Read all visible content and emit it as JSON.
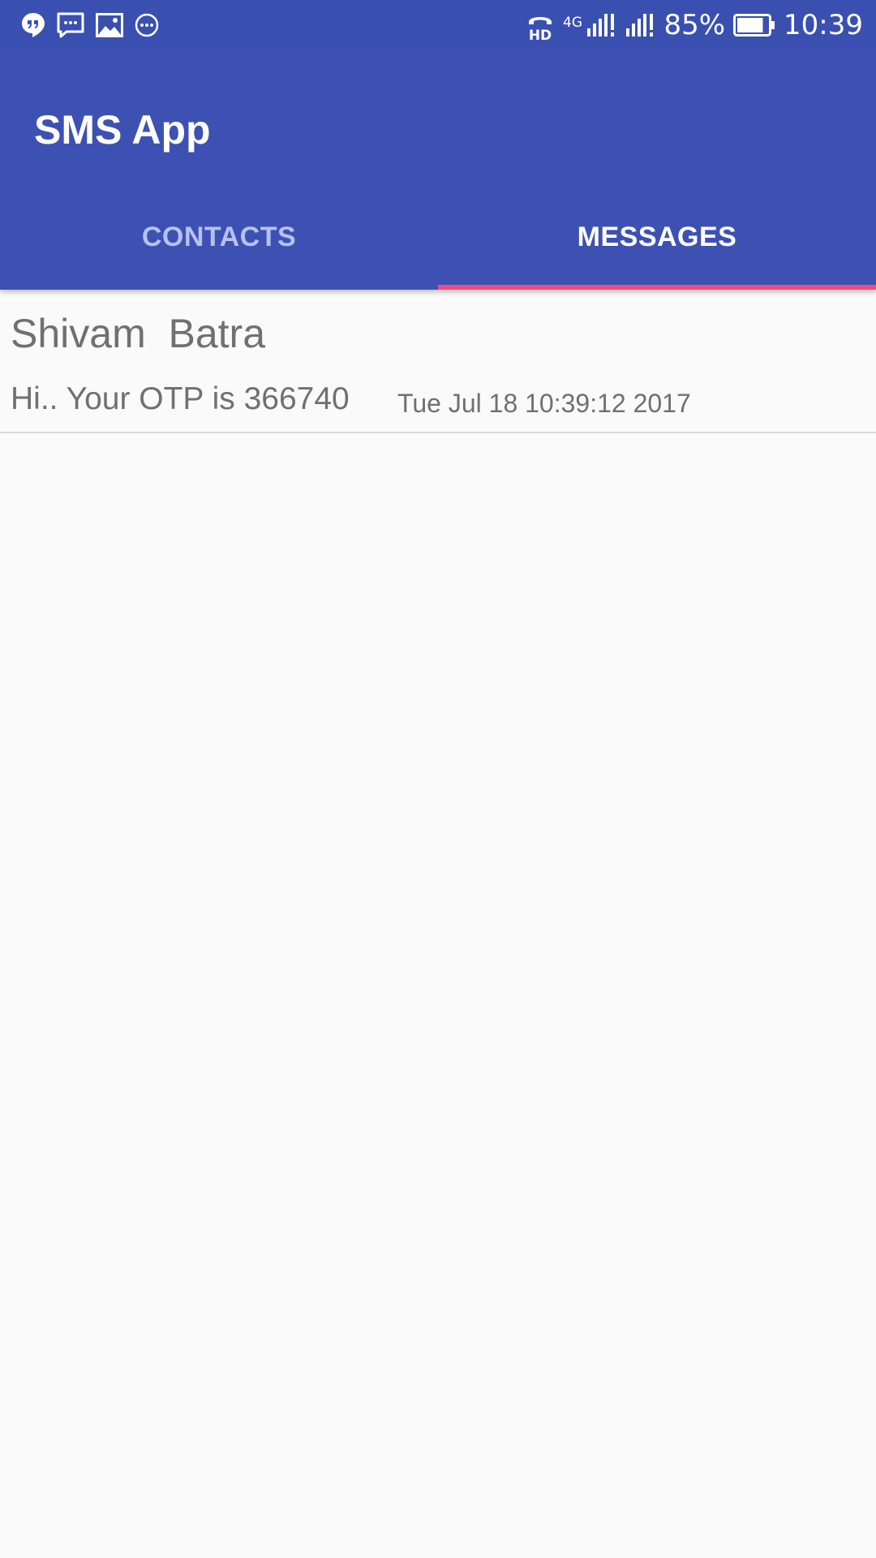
{
  "status_bar": {
    "left_icons": [
      "hangouts-icon",
      "sms-icon",
      "gallery-icon",
      "more-notifications-icon"
    ],
    "right_icons": [
      "hd-call-icon",
      "4g-signal-icon",
      "signal-icon",
      "battery-icon"
    ],
    "network_label": "4G",
    "hd_label": "HD",
    "battery_percent": "85%",
    "battery_level": 0.85,
    "time": "10:39"
  },
  "app_bar": {
    "title": "SMS App",
    "color": "#3d51b3"
  },
  "tabs": [
    {
      "label": "CONTACTS",
      "active": false
    },
    {
      "label": "MESSAGES",
      "active": true
    }
  ],
  "accent_color": "#ef4a82",
  "messages": [
    {
      "sender": "Shivam  Batra",
      "body": "Hi.. Your OTP is 366740",
      "timestamp": "Tue Jul 18 10:39:12 2017"
    }
  ]
}
